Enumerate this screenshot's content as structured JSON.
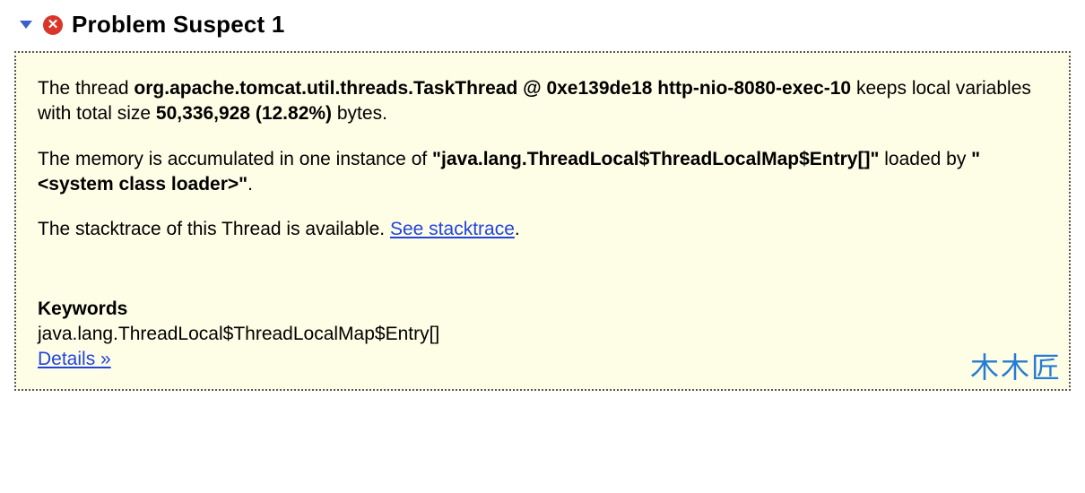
{
  "header": {
    "title": "Problem Suspect 1"
  },
  "error_icon_glyph": "✕",
  "paragraph1": {
    "text_a": "The thread ",
    "bold_thread": "org.apache.tomcat.util.threads.TaskThread @ 0xe139de18 http-nio-8080-exec-10",
    "text_b": " keeps local variables with total size ",
    "bold_size": "50,336,928 (12.82%)",
    "text_c": " bytes."
  },
  "paragraph2": {
    "text_a": "The memory is accumulated in one instance of ",
    "bold_class": "\"java.lang.ThreadLocal$ThreadLocalMap$Entry[]\"",
    "text_b": " loaded by ",
    "bold_loader": "\"<system class loader>\"",
    "text_c": "."
  },
  "paragraph3": {
    "text_a": "The stacktrace of this Thread is available. ",
    "link_label": "See stacktrace",
    "text_b": "."
  },
  "keywords": {
    "label": "Keywords",
    "value": "java.lang.ThreadLocal$ThreadLocalMap$Entry[]",
    "details_link": "Details »"
  },
  "watermark": "木木匠"
}
